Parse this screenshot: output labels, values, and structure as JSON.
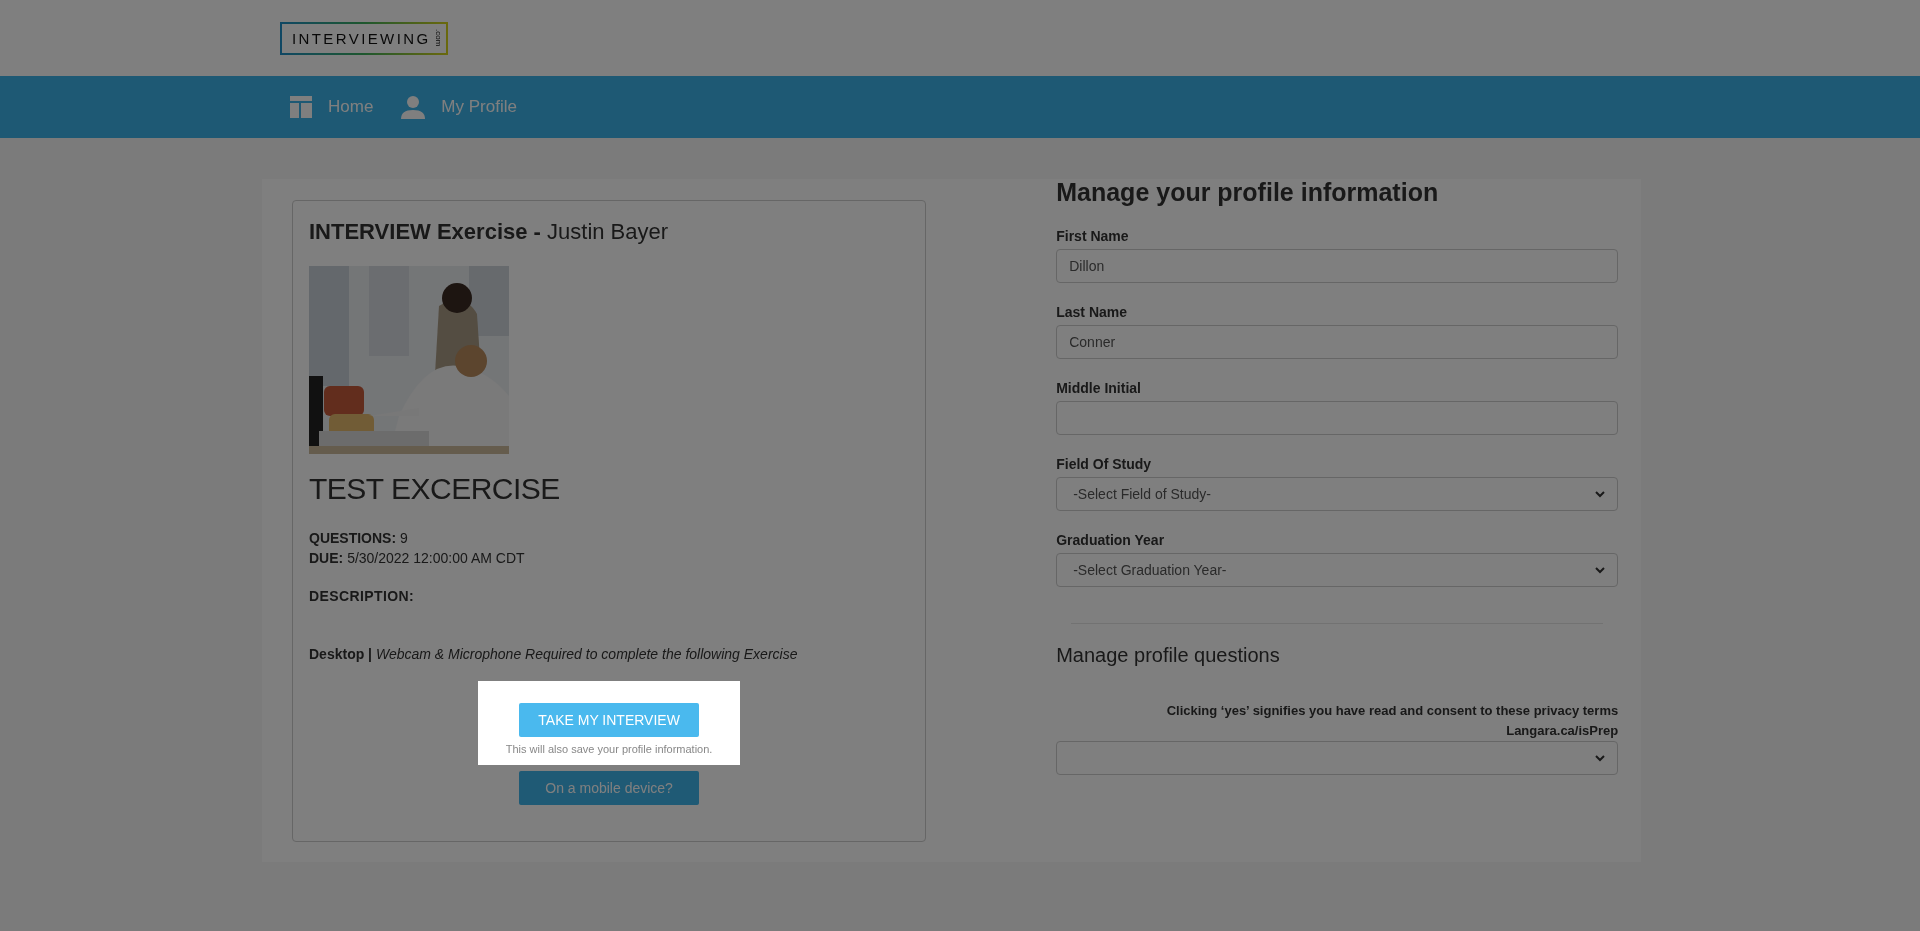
{
  "header": {
    "logo": "INTERVIEWING",
    "logo_suffix": ".com"
  },
  "nav": [
    {
      "label": "Home"
    },
    {
      "label": "My Profile"
    }
  ],
  "exercise": {
    "title_bold": "INTERVIEW Exercise -",
    "title_name": "Justin Bayer",
    "heading": "TEST EXCERCISE",
    "details": [
      {
        "label": "QUESTIONS:",
        "value": "9"
      },
      {
        "label": "DUE:",
        "value": "5/30/2022 12:00:00 AM CDT"
      }
    ],
    "description_label": "DESCRIPTION:",
    "requirement": "**Desktop |** *Webcam & Microphone Required to complete the following Exercise*",
    "primary_button": "TAKE MY INTERVIEW",
    "primary_hint": "This will also save your profile information.",
    "spotlight": true,
    "secondary_button": "On a mobile device?"
  },
  "profile": {
    "heading": "Manage your profile information",
    "fields": [
      {
        "kind": "text",
        "label": "First Name",
        "value": "Dillon"
      },
      {
        "kind": "text",
        "label": "Last Name",
        "value": "Conner"
      },
      {
        "kind": "text",
        "label": "Middle Initial"
      },
      {
        "kind": "select",
        "label": "Field Of Study",
        "value": "-Select Field of Study-"
      },
      {
        "kind": "select",
        "label": "Graduation Year",
        "value": "-Select Graduation Year-"
      }
    ],
    "questions_heading": "Manage profile questions",
    "consent": "Clicking ‘yes’ signifies you have read and consent to these privacy terms",
    "consent_link": "Langara.ca/isPrep"
  }
}
